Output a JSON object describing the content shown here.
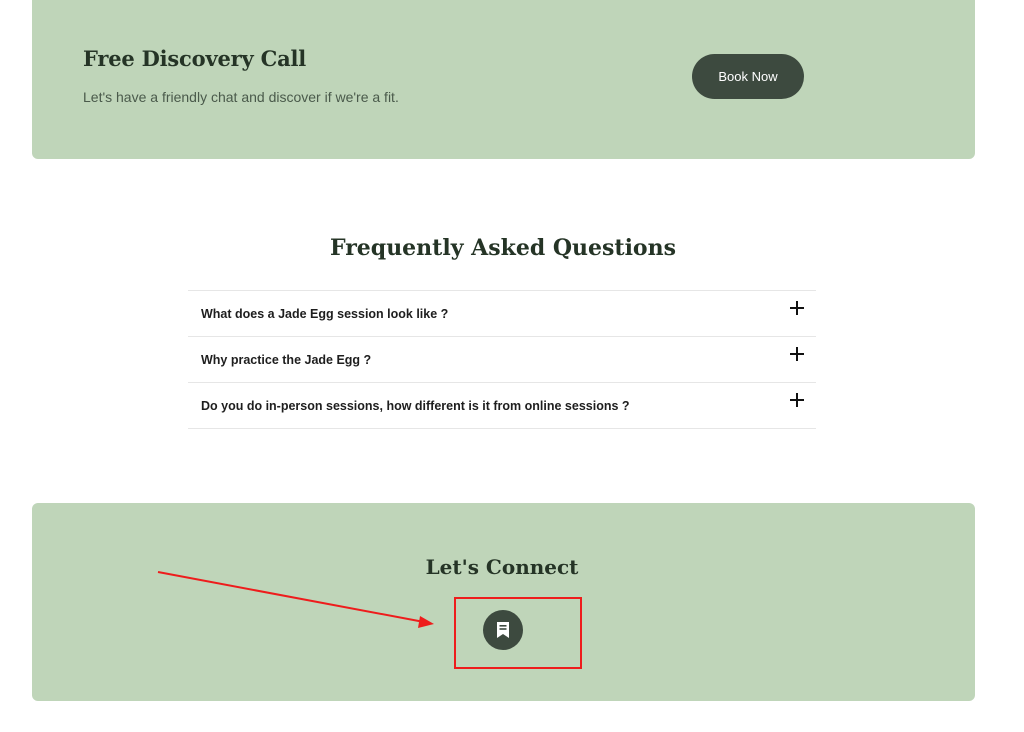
{
  "discovery": {
    "title": "Free Discovery Call",
    "subtitle": "Let's have a friendly chat and discover if we're a fit.",
    "button_label": "Book Now"
  },
  "faq": {
    "title": "Frequently Asked Questions",
    "items": [
      {
        "question": "What does a Jade Egg session look like ?",
        "icon": "plus-icon"
      },
      {
        "question": "Why practice the Jade Egg ?",
        "icon": "plus-icon"
      },
      {
        "question": "Do you do in-person sessions, how different is it from online sessions ?",
        "icon": "plus-icon"
      }
    ]
  },
  "connect": {
    "title": "Let's Connect",
    "social_icon": "bookmark-icon"
  },
  "colors": {
    "banner_bg": "#bfd5b9",
    "dark_green": "#3d4a3f",
    "heading": "#253426",
    "annotation_red": "#ee1c1c"
  }
}
